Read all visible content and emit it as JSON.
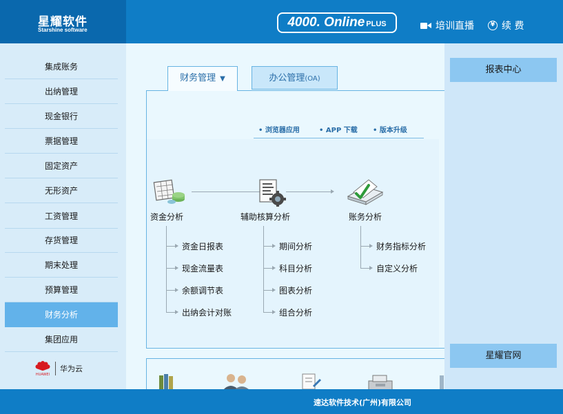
{
  "header": {
    "logo_cn": "星耀软件",
    "logo_en": "Starshine software",
    "product_name": "4000. Online",
    "product_plus": "PLUS",
    "live_training": "培训直播",
    "renew": "续 费"
  },
  "sidebar": {
    "items": [
      {
        "label": "集成账务"
      },
      {
        "label": "出纳管理"
      },
      {
        "label": "现金银行"
      },
      {
        "label": "票据管理"
      },
      {
        "label": "固定资产"
      },
      {
        "label": "无形资产"
      },
      {
        "label": "工资管理"
      },
      {
        "label": "存货管理"
      },
      {
        "label": "期末处理"
      },
      {
        "label": "预算管理"
      },
      {
        "label": "财务分析",
        "active": true
      },
      {
        "label": "集团应用"
      }
    ],
    "partner": {
      "name": "华为云",
      "brand": "HUAWEI"
    }
  },
  "tabs": {
    "finance": "财务管理",
    "oa": "办公管理",
    "oa_suffix": "(OA)"
  },
  "quick_links": {
    "browser": "• 浏览器应用",
    "app": "• APP 下载",
    "upgrade": "• 版本升级"
  },
  "flow": {
    "nodes": [
      {
        "label": "资金分析",
        "icon": "fund-chart-icon"
      },
      {
        "label": "辅助核算分析",
        "icon": "document-gear-icon"
      },
      {
        "label": "账务分析",
        "icon": "ledger-check-icon"
      }
    ],
    "fund_items": [
      "资金日报表",
      "现金流量表",
      "余额调节表",
      "出纳会计对账"
    ],
    "aux_items": [
      "期间分析",
      "科目分析",
      "图表分析",
      "组合分析"
    ],
    "ledger_items": [
      "财务指标分析",
      "自定义分析"
    ]
  },
  "right": {
    "report_center": "报表中心",
    "official_site": "星耀官网"
  },
  "footer": {
    "company": "速达软件技术(广州)有限公司"
  },
  "colors": {
    "header_blue": "#0f7dc6",
    "sidebar_active": "#62b2ea",
    "right_button": "#8cc7f1"
  }
}
